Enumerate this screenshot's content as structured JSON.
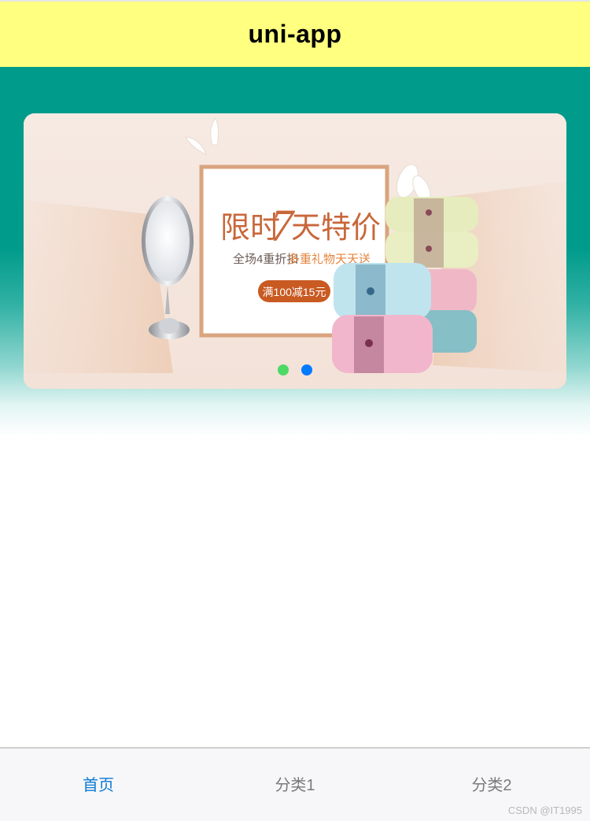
{
  "navbar": {
    "title": "uni-app"
  },
  "banner": {
    "headline_part1": "限时",
    "headline_number": "7",
    "headline_part2": "天特价",
    "subline_plain": "全场4重折扣",
    "subline_highlight": "多重礼物天天送",
    "coupon": "满100减15元",
    "indicator": {
      "count": 2,
      "active_index": 1,
      "colors": {
        "inactive": "#4cd964",
        "active": "#007aff"
      }
    }
  },
  "tabbar": {
    "items": [
      {
        "label": "首页",
        "active": true
      },
      {
        "label": "分类1",
        "active": false
      },
      {
        "label": "分类2",
        "active": false
      }
    ],
    "active_color": "#0a7ad2",
    "inactive_color": "#7a7a7a"
  },
  "watermark": "CSDN @IT1995",
  "colors": {
    "navbar": "#ffff80",
    "hero": "#009b8b"
  }
}
